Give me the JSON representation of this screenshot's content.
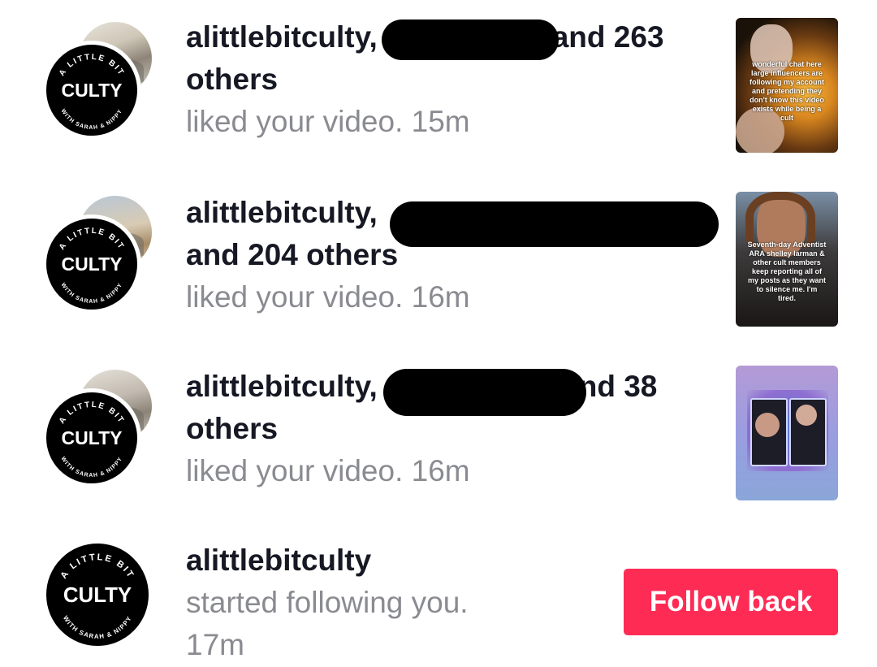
{
  "notifications": [
    {
      "username": "alittlebitculty,",
      "line1_tail": "and",
      "count": "263",
      "line2": "others",
      "action": "liked your video.",
      "time": "15m",
      "thumb_caption": "wonderful chat here large influencers are following my account and pretending they don't know this video exists while being a cult"
    },
    {
      "username": "alittlebitculty,",
      "line2_prefix": "and",
      "count": "204",
      "line2_suffix": "others",
      "action": "liked your video.",
      "time": "16m",
      "thumb_caption": "Seventh-day Adventist ARA shelley larman & other cult members keep reporting all of my posts as they want to silence me. I'm tired."
    },
    {
      "username": "alittlebitculty,",
      "line1_tail": "nd",
      "count": "38",
      "line2": "others",
      "action": "liked your video.",
      "time": "16m"
    },
    {
      "username": "alittlebitculty",
      "action": "started following you.",
      "time": "17m",
      "button": "Follow back"
    }
  ],
  "logo": {
    "top_text": "A LITTLE BIT",
    "center_text": "CULTY",
    "bottom_text": "WITH SARAH & NIPPY"
  },
  "colors": {
    "primary_text": "#161823",
    "secondary_text": "#8a8b91",
    "accent": "#fe2c55",
    "background": "#ffffff"
  }
}
